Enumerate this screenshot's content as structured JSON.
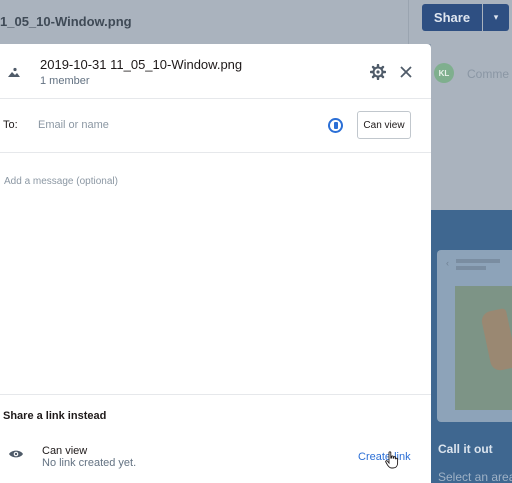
{
  "background": {
    "title": "1_05_10-Window.png",
    "share_label": "Share",
    "share_caret": "▾",
    "avatar_initials": "KL",
    "comment_placeholder": "Comme",
    "promo_title": "Call it out",
    "promo_subtitle": "Select an area"
  },
  "modal": {
    "title": "2019-10-31 11_05_10-Window.png",
    "subtitle": "1 member",
    "to_label": "To:",
    "to_placeholder": "Email or name",
    "permission_label": "Can view",
    "message_placeholder": "Add a message (optional)",
    "link_section": {
      "title": "Share a link instead",
      "permission": "Can view",
      "status": "No link created yet.",
      "create_label": "Create link"
    }
  },
  "colors": {
    "accent": "#2b6fd6",
    "share_button": "#2e4f82",
    "overlay": "#8e9cac"
  }
}
